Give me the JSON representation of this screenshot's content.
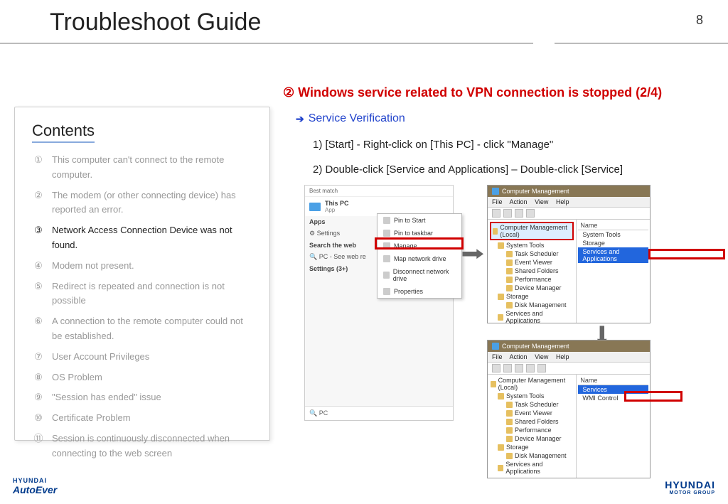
{
  "page": {
    "title": "Troubleshoot Guide",
    "number": "8"
  },
  "contents": {
    "heading": "Contents",
    "items": [
      "This computer can't connect to the remote computer.",
      "The modem (or other connecting device) has reported an error.",
      "Network Access Connection Device was not found.",
      "Modem not present.",
      "Redirect is repeated and connection is not possible",
      "A connection to the remote computer could not be established.",
      "User Account Privileges",
      "OS Problem",
      "\"Session has ended\" issue",
      "Certificate Problem",
      "Session is continuously disconnected when connecting to the web screen"
    ],
    "numbers": [
      "①",
      "②",
      "③",
      "④",
      "⑤",
      "⑥",
      "⑦",
      "⑧",
      "⑨",
      "⑩",
      "⑪"
    ]
  },
  "section": {
    "number": "②",
    "title": "Windows service related to VPN connection is stopped (2/4)",
    "sub": "Service Verification",
    "step1": "1) [Start] - Right-click on [This PC] - click \"Manage\"",
    "step2": "2) Double-click [Service and Applications] – Double-click [Service]"
  },
  "shot1": {
    "best_match": "Best match",
    "this_pc": "This PC",
    "app": "App",
    "apps": "Apps",
    "settings": "Settings",
    "search_web": "Search the web",
    "pc_web": "PC - See web re",
    "settings3": "Settings (3+)",
    "search": "PC",
    "ctx": {
      "pin_start": "Pin to Start",
      "pin_taskbar": "Pin to taskbar",
      "manage": "Manage",
      "map": "Map network drive",
      "disconnect": "Disconnect network drive",
      "properties": "Properties"
    }
  },
  "cm": {
    "title": "Computer Management",
    "file": "File",
    "action": "Action",
    "view": "View",
    "help": "Help",
    "root": "Computer Management (Local)",
    "system_tools": "System Tools",
    "task_scheduler": "Task Scheduler",
    "event_viewer": "Event Viewer",
    "shared_folders": "Shared Folders",
    "performance": "Performance",
    "device_manager": "Device Manager",
    "storage": "Storage",
    "disk_mgmt": "Disk Management",
    "svc_apps": "Services and Applications",
    "name": "Name",
    "services": "Services",
    "wmi": "WMI Control",
    "r_system_tools": "System Tools",
    "r_storage": "Storage"
  },
  "logos": {
    "left1": "HYUNDAI",
    "left2": "AutoEver",
    "right1": "HYUNDAI",
    "right2": "MOTOR GROUP"
  }
}
